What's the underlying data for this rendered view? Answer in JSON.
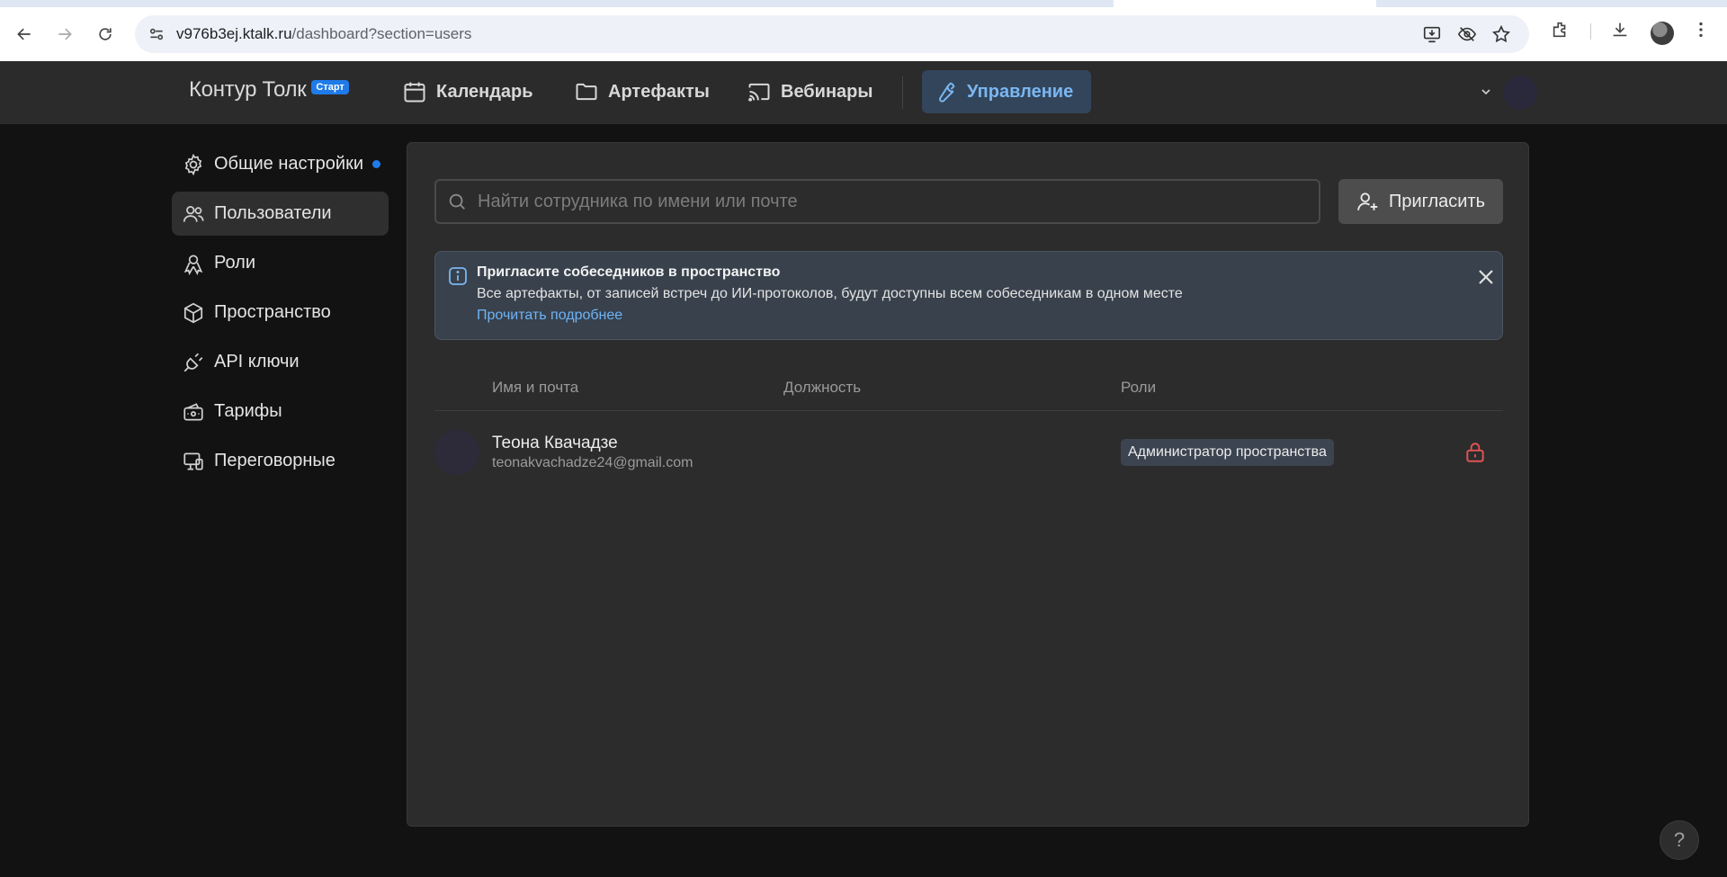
{
  "browser": {
    "url_host": "v976b3ej.ktalk.ru",
    "url_path": "/dashboard?section=users"
  },
  "header": {
    "logo": "Контур Толк",
    "logo_badge": "Старт",
    "nav": [
      {
        "label": "Календарь",
        "icon": "calendar-icon"
      },
      {
        "label": "Артефакты",
        "icon": "folder-icon"
      },
      {
        "label": "Вебинары",
        "icon": "cast-icon"
      },
      {
        "label": "Управление",
        "icon": "wrench-icon",
        "active": true
      }
    ]
  },
  "sidebar": {
    "items": [
      {
        "label": "Общие настройки",
        "icon": "gear-icon",
        "has_dot": true
      },
      {
        "label": "Пользователи",
        "icon": "users-icon",
        "active": true
      },
      {
        "label": "Роли",
        "icon": "roles-icon"
      },
      {
        "label": "Пространство",
        "icon": "cube-icon"
      },
      {
        "label": "API ключи",
        "icon": "plug-icon"
      },
      {
        "label": "Тарифы",
        "icon": "wallet-icon"
      },
      {
        "label": "Переговорные",
        "icon": "devices-icon"
      }
    ]
  },
  "search": {
    "placeholder": "Найти сотрудника по имени или почте",
    "value": ""
  },
  "invite_button": {
    "label": "Пригласить"
  },
  "banner": {
    "title": "Пригласите собеседников в пространство",
    "text": "Все артефакты, от записей встреч до ИИ-протоколов, будут доступны всем собеседникам в одном месте",
    "link": "Прочитать подробнее"
  },
  "table": {
    "columns": [
      "Имя и почта",
      "Должность",
      "Роли"
    ],
    "rows": [
      {
        "name": "Теона Квачадзе",
        "email": "teonakvachadze24@gmail.com",
        "position": "",
        "role": "Администратор пространства",
        "locked": true
      }
    ]
  },
  "help": {
    "label": "?"
  },
  "colors": {
    "accent": "#1f7bea",
    "active_nav_text": "#7ab7f2",
    "link": "#6eb4f7",
    "lock": "#e05454"
  }
}
